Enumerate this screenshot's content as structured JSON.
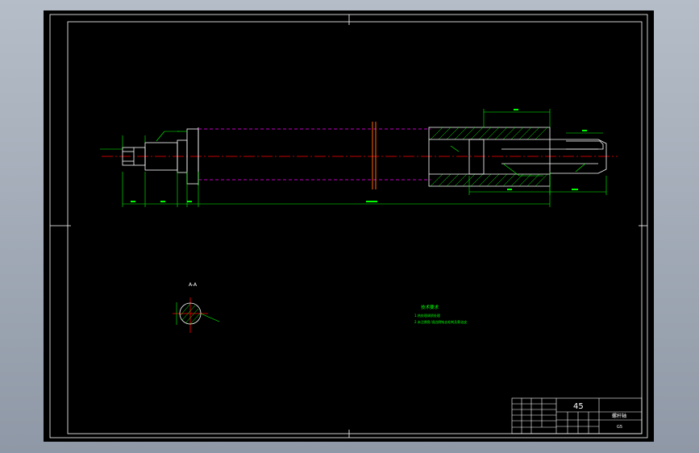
{
  "colors": {
    "viewport_bg": "#9aa3af",
    "sheet_bg": "#000000",
    "frame": "#ffffff",
    "dimension": "#00ff00",
    "centerline": "#ff0000",
    "hidden_line": "#ff00ff",
    "outline": "#ffffff",
    "hatch": "#00ff00"
  },
  "title_block": {
    "material": "45",
    "title": "螺杆轴",
    "scale": "G5"
  },
  "section": {
    "label": "A-A"
  },
  "notes": {
    "heading": "技术要求",
    "line1": "1.热处理调质处理",
    "line2": "2.未注倒角 锐边倒钝去毛刺及氧化皮"
  }
}
